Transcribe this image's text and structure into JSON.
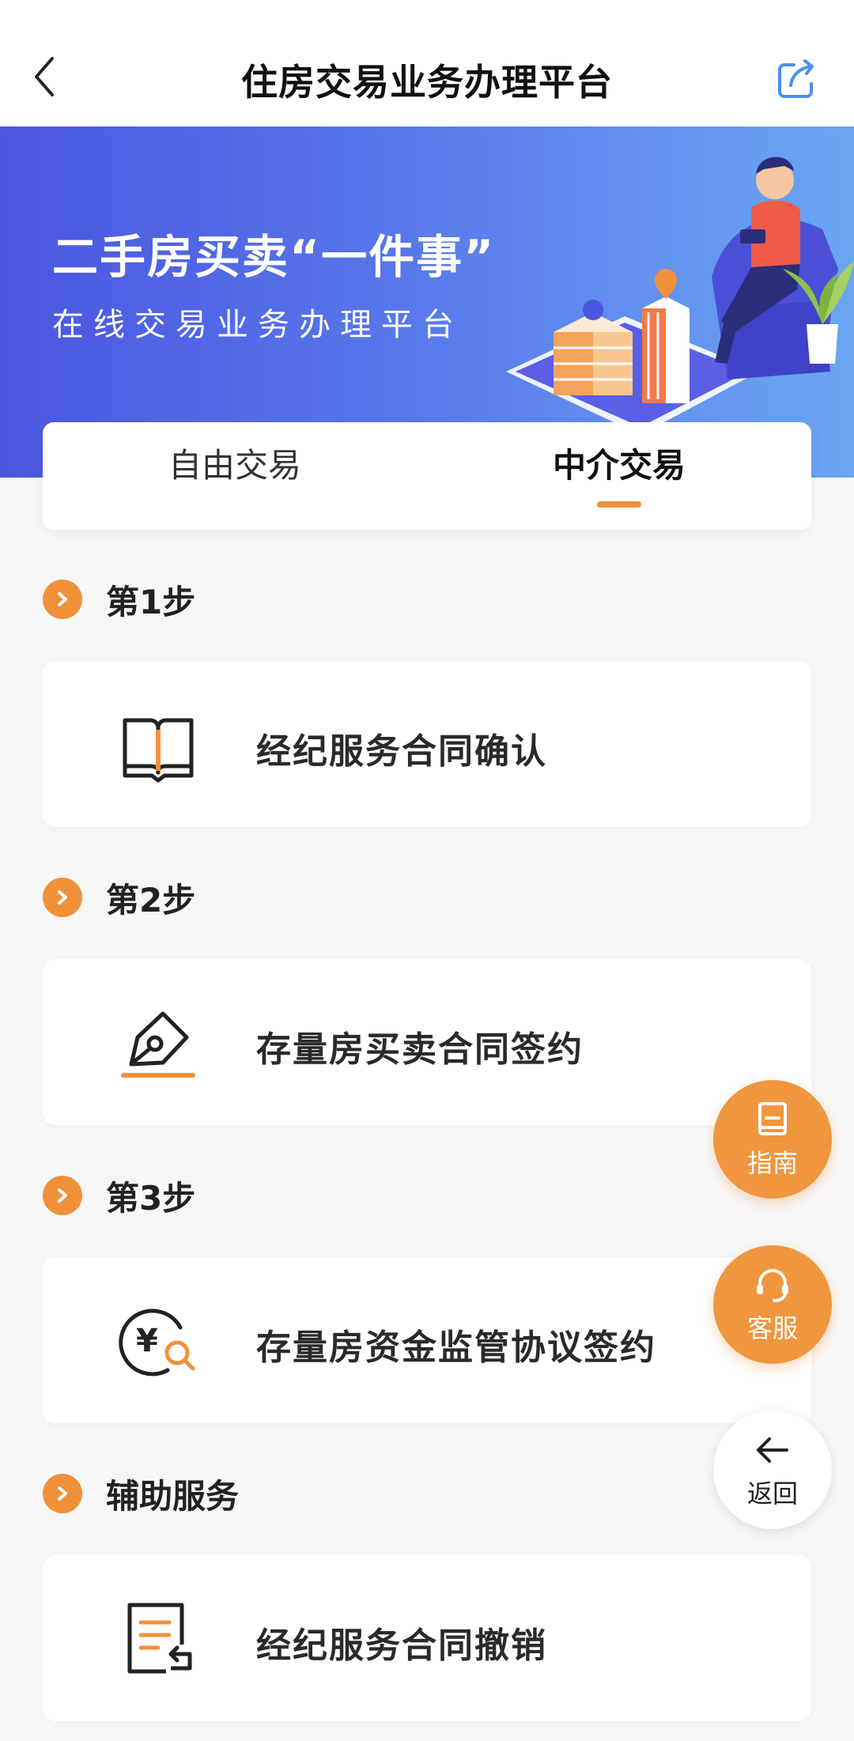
{
  "nav": {
    "title": "住房交易业务办理平台",
    "back_icon": "chevron-left-icon",
    "share_icon": "share-icon"
  },
  "banner": {
    "title": "二手房买卖“一件事”",
    "subtitle": "在线交易业务办理平台"
  },
  "tabs": [
    {
      "label": "自由交易",
      "active": false
    },
    {
      "label": "中介交易",
      "active": true
    }
  ],
  "steps": [
    {
      "header": "第1步",
      "card_label": "经纪服务合同确认",
      "icon": "book-icon"
    },
    {
      "header": "第2步",
      "card_label": "存量房买卖合同签约",
      "icon": "pen-nib-icon"
    },
    {
      "header": "第3步",
      "card_label": "存量房资金监管协议签约",
      "icon": "yuan-search-icon"
    },
    {
      "header": "辅助服务",
      "card_label": "经纪服务合同撤销",
      "icon": "document-revoke-icon"
    }
  ],
  "floating": {
    "guide_label": "指南",
    "service_label": "客服",
    "back_label": "返回"
  },
  "colors": {
    "accent": "#f0923b",
    "banner_start": "#4a56e0",
    "banner_end": "#6aa6f2"
  }
}
